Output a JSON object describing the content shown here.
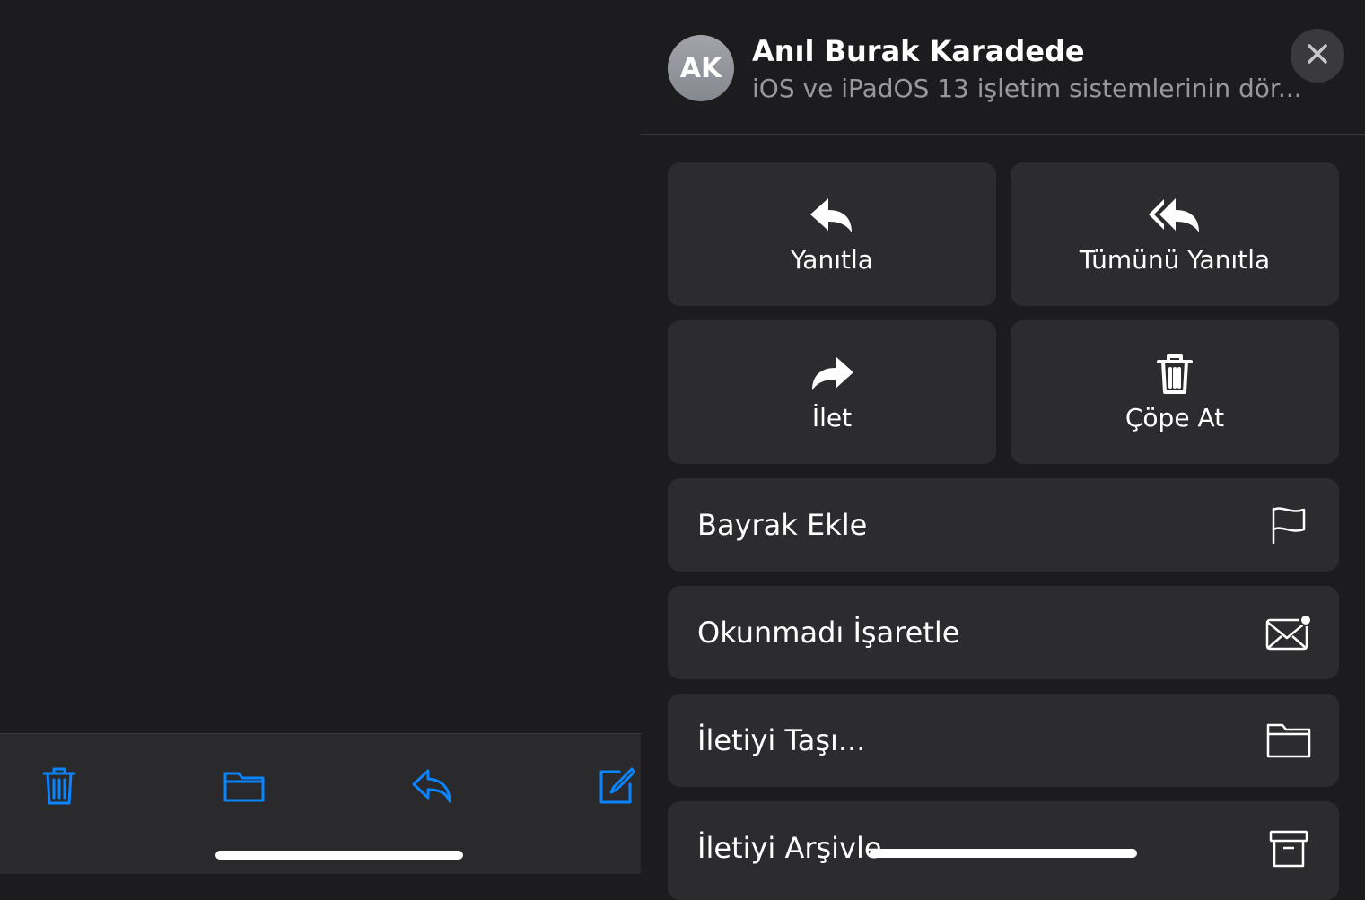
{
  "left_pane": {
    "toolbar": {
      "trash_icon": "trash-icon",
      "folder_icon": "folder-icon",
      "reply_icon": "reply-icon",
      "compose_icon": "compose-icon",
      "accent_color": "#0a84ff"
    }
  },
  "sheet": {
    "avatar_initials": "AK",
    "sender_name": "Anıl Burak Karadede",
    "subject_preview": "iOS ve iPadOS 13 işletim sistemlerinin dör...",
    "tiles": [
      {
        "label": "Yanıtla",
        "icon": "reply-icon"
      },
      {
        "label": "Tümünü Yanıtla",
        "icon": "reply-all-icon"
      },
      {
        "label": "İlet",
        "icon": "forward-icon"
      },
      {
        "label": "Çöpe At",
        "icon": "trash-icon"
      }
    ],
    "rows": [
      {
        "label": "Bayrak Ekle",
        "icon": "flag-icon"
      },
      {
        "label": "Okunmadı İşaretle",
        "icon": "unread-envelope-icon"
      },
      {
        "label": "İletiyi Taşı...",
        "icon": "folder-icon"
      },
      {
        "label": "İletiyi Arşivle",
        "icon": "archive-icon"
      }
    ]
  }
}
